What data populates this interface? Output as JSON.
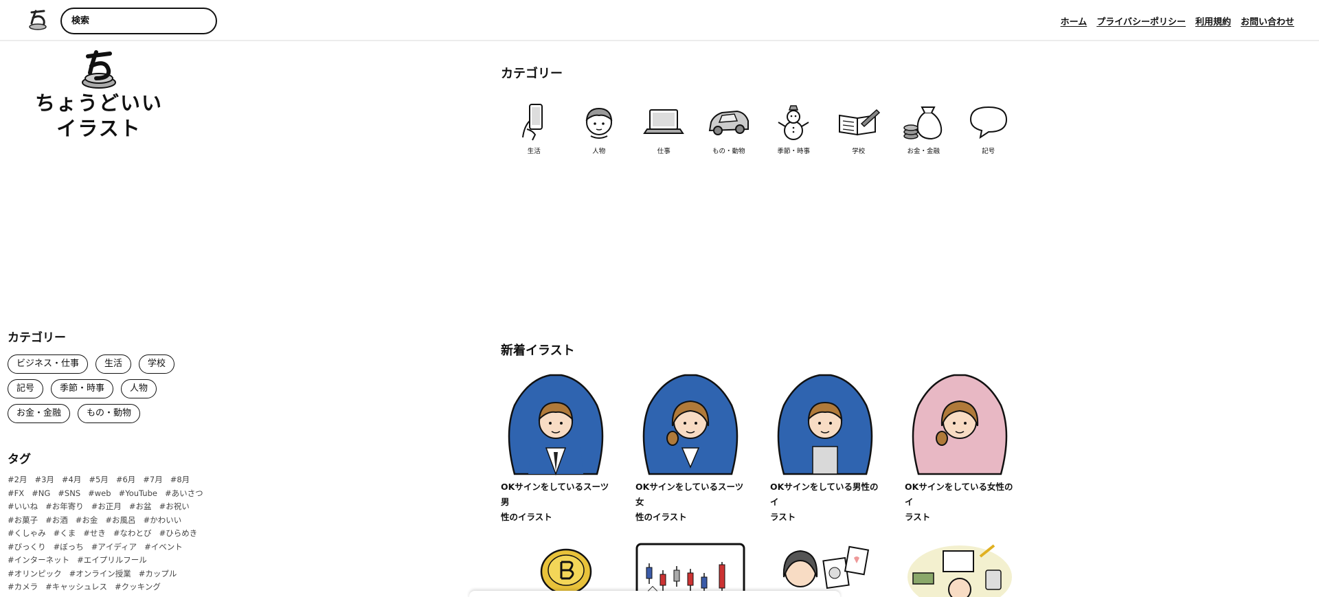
{
  "header": {
    "search_placeholder": "検索",
    "nav": [
      "ホーム",
      "プライバシーポリシー",
      "利用規約",
      "お問い合わせ"
    ]
  },
  "site": {
    "title_line1": "ちょうどいい",
    "title_line2": "イラスト"
  },
  "categories_section": {
    "heading": "カテゴリー",
    "items": [
      {
        "label": "生活",
        "icon": "smartphone-hand-icon"
      },
      {
        "label": "人物",
        "icon": "person-face-icon"
      },
      {
        "label": "仕事",
        "icon": "laptop-icon"
      },
      {
        "label": "もの・動物",
        "icon": "car-icon"
      },
      {
        "label": "季節・時事",
        "icon": "snowman-icon"
      },
      {
        "label": "学校",
        "icon": "notebook-pencil-icon"
      },
      {
        "label": "お金・金融",
        "icon": "money-bag-icon"
      },
      {
        "label": "記号",
        "icon": "speech-bubble-icon"
      }
    ]
  },
  "sidebar": {
    "category_heading": "カテゴリー",
    "category_rows": [
      [
        "ビジネス・仕事",
        "生活",
        "学校"
      ],
      [
        "記号",
        "季節・時事",
        "人物"
      ],
      [
        "お金・金融",
        "もの・動物"
      ]
    ],
    "tag_heading": "タグ",
    "tag_rows": [
      [
        "#2月",
        "#3月",
        "#4月",
        "#5月",
        "#6月",
        "#7月",
        "#8月"
      ],
      [
        "#FX",
        "#NG",
        "#SNS",
        "#web",
        "#YouTube",
        "#あいさつ"
      ],
      [
        "#いいね",
        "#お年寄り",
        "#お正月",
        "#お盆",
        "#お祝い"
      ],
      [
        "#お菓子",
        "#お酒",
        "#お金",
        "#お風呂",
        "#かわいい"
      ],
      [
        "#くしゃみ",
        "#くま",
        "#せき",
        "#なわとび",
        "#ひらめき"
      ],
      [
        "#びっくり",
        "#ぼっち",
        "#アイディア",
        "#イベント"
      ],
      [
        "#インターネット",
        "#エイプリルフール"
      ],
      [
        "#オリンピック",
        "#オンライン授業",
        "#カップル"
      ],
      [
        "#カメラ",
        "#キャッシュレス",
        "#クッキング"
      ]
    ]
  },
  "new_section": {
    "heading": "新着イラスト",
    "cards": [
      {
        "title": "OKサインをしているスーツ男性のイラスト",
        "line1": "OKサインをしているスーツ男",
        "line2": "性のイラスト",
        "shirt": "#2f64b0"
      },
      {
        "title": "OKサインをしているスーツ女性のイラスト",
        "line1": "OKサインをしているスーツ女",
        "line2": "性のイラスト",
        "shirt": "#2f64b0"
      },
      {
        "title": "OKサインをしている男性のイラスト",
        "line1": "OKサインをしている男性のイ",
        "line2": "ラスト",
        "shirt": "#2f64b0"
      },
      {
        "title": "OKサインをしている女性のイラスト",
        "line1": "OKサインをしている女性のイ",
        "line2": "ラスト",
        "shirt": "#e8b8c4"
      }
    ],
    "second_row": [
      "bitcoin-coin-icon",
      "candlestick-chart-icon",
      "woman-documents-icon",
      "household-budget-icon"
    ]
  }
}
